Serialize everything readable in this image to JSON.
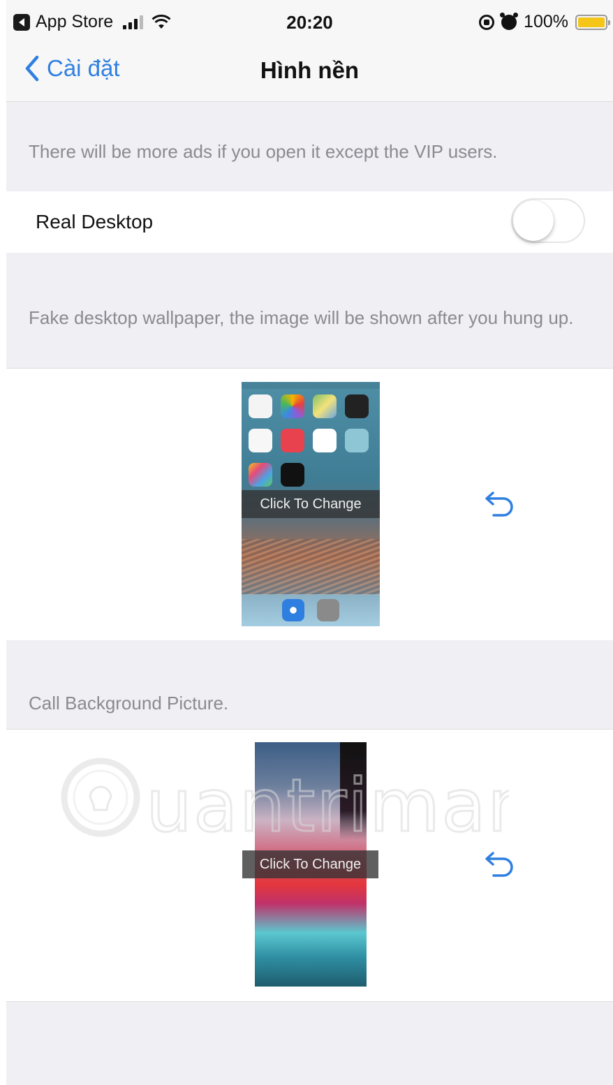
{
  "status_bar": {
    "carrier": "App Store",
    "time": "20:20",
    "battery": "100%"
  },
  "nav": {
    "back_label": "Cài đặt",
    "title": "Hình nền"
  },
  "notes": {
    "ads": "There will be more ads if you open it except the VIP users.",
    "fake_desktop": "Fake desktop wallpaper, the image will be shown after you hung up.",
    "call_background": "Call Background Picture."
  },
  "real_desktop": {
    "label": "Real Desktop",
    "enabled": false
  },
  "thumbnails": {
    "fake_change_label": "Click To Change",
    "call_change_label": "Click To Change"
  },
  "colors": {
    "accent": "#2f7fe0",
    "group_background": "#efeff4",
    "note_text": "#8a8a8f",
    "battery": "#f5c518"
  },
  "icons": {
    "back": "chevron-left-icon",
    "reset": "undo-arrow-icon"
  },
  "watermark_text": "Quantrimang"
}
